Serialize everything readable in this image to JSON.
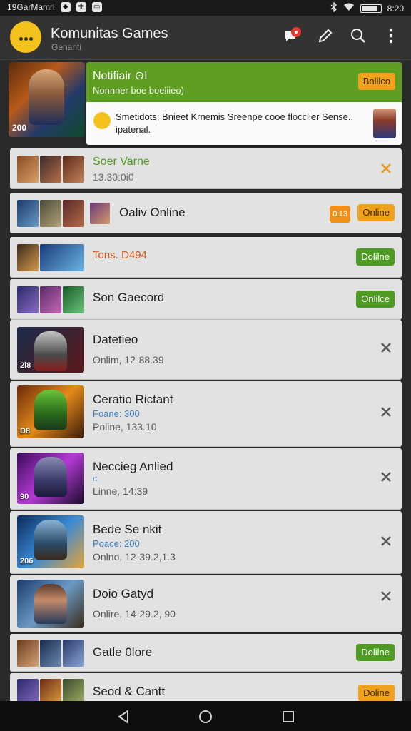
{
  "status_bar": {
    "carrier": "19GarMamri",
    "time": "8:20"
  },
  "app": {
    "title": "Komunitas Games",
    "subtitle": "Genanti"
  },
  "featured": {
    "thumb_badge": "200",
    "title": "Notifiair ⊙I",
    "subtitle": "Nonnner boe boeliieo)",
    "status": "Bnlilco",
    "message": "Smetidots; Bnieet Krnemis Sreenpe cooe flocclier Sense.. ipatenal."
  },
  "rows": [
    {
      "name": "Soer Varne",
      "line2": "13.30:0i0",
      "action": "close",
      "name_color": "#4f9a1e",
      "line2_color": "#666666"
    },
    {
      "name": "Oaliv Online",
      "badge": "0i13",
      "status": "Online",
      "status_color": "orange"
    },
    {
      "name": "Tons. D494",
      "status": "Dolilne",
      "status_color": "green",
      "name_color": "#d25a1a"
    },
    {
      "name": "Son Gaecord",
      "status": "Onlilce",
      "status_color": "green"
    },
    {
      "name": "Datetieo",
      "line2": "Onlim, 12-88.39",
      "thumb_badge": "2i8",
      "action": "close"
    },
    {
      "name": "Ceratio Rictant",
      "line1": "Foane: 300",
      "line2": "Poline, 133.10",
      "thumb_badge": "D8",
      "action": "close"
    },
    {
      "name": "Neccieg Anlied",
      "line1": "rt",
      "line2": "Linne, 14:39",
      "thumb_badge": "90",
      "action": "close"
    },
    {
      "name": "Bede Se nkit",
      "line1": "Poace: 200",
      "line2": "Onlno, 12-39.2,1.3",
      "thumb_badge": "206",
      "action": "close"
    },
    {
      "name": "Doio Gatyd",
      "line2": "Onlire, 14-29.2, 90",
      "action": "close"
    },
    {
      "name": "Gatle 0lore",
      "status": "Dolilne",
      "status_color": "green"
    },
    {
      "name": "Seod & Cantt",
      "status": "Doline",
      "status_color": "orange"
    }
  ],
  "icons": {
    "appbar": [
      "chat-notification-icon",
      "edit-icon",
      "search-icon",
      "more-vert-icon"
    ],
    "navbar": [
      "back-icon",
      "home-icon",
      "recents-icon"
    ]
  },
  "colors": {
    "accent_green": "#5e9f21",
    "accent_orange": "#f0a21d",
    "list_bg": "#e2e2e2"
  }
}
